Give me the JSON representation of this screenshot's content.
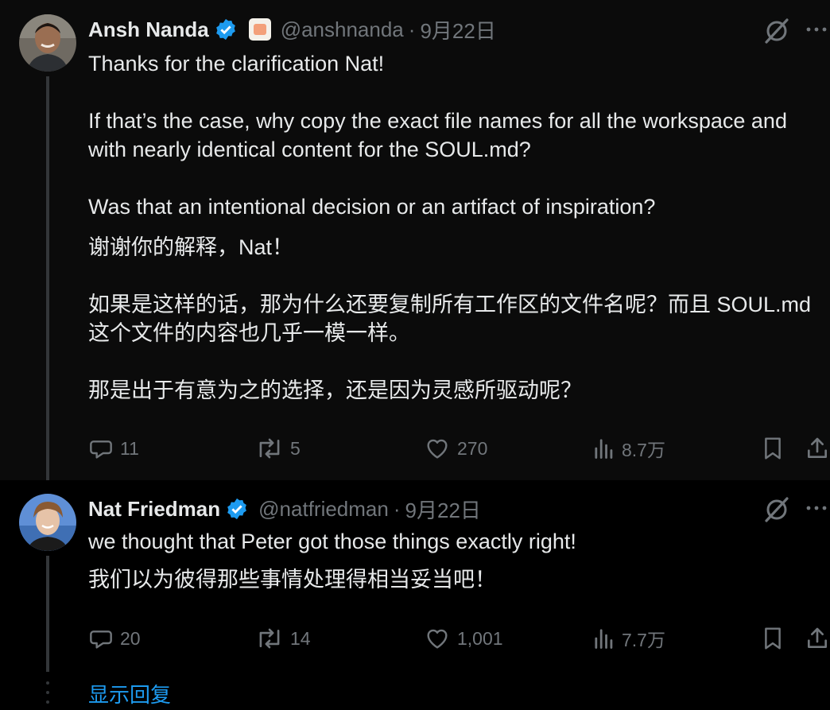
{
  "tweets": [
    {
      "author": "Ansh Nanda",
      "handle": "@anshnanda",
      "date": "9月22日",
      "paragraphs": [
        "Thanks for the clarification Nat!\n\nIf that’s the case, why copy the exact file names for all the workspace and with nearly identical content for the SOUL.md?\n\nWas that an intentional decision or an artifact of inspiration?",
        "谢谢你的解释，Nat！\n\n如果是这样的话，那为什么还要复制所有工作区的文件名呢？而且 SOUL.md 这个文件的内容也几乎一模一样。\n\n那是出于有意为之的选择，还是因为灵感所驱动呢？"
      ],
      "replies": "11",
      "reposts": "5",
      "likes": "270",
      "views": "8.7万"
    },
    {
      "author": "Nat Friedman",
      "handle": "@natfriedman",
      "date": "9月22日",
      "paragraphs": [
        "we thought that Peter got those things exactly right!",
        "我们以为彼得那些事情处理得相当妥当吧！"
      ],
      "replies": "20",
      "reposts": "14",
      "likes": "1,001",
      "views": "7.7万"
    }
  ],
  "show_replies_label": "显示回复",
  "colors": {
    "background": "#000000",
    "text": "#e7e9ea",
    "muted": "#71767b",
    "verified": "#1d9bf0",
    "link": "#1d9bf0",
    "thread_line": "#333639"
  },
  "icons": [
    "verified-badge-icon",
    "affiliate-badge-icon",
    "grok-icon",
    "more-icon",
    "reply-icon",
    "repost-icon",
    "like-icon",
    "views-icon",
    "bookmark-icon",
    "share-icon"
  ]
}
